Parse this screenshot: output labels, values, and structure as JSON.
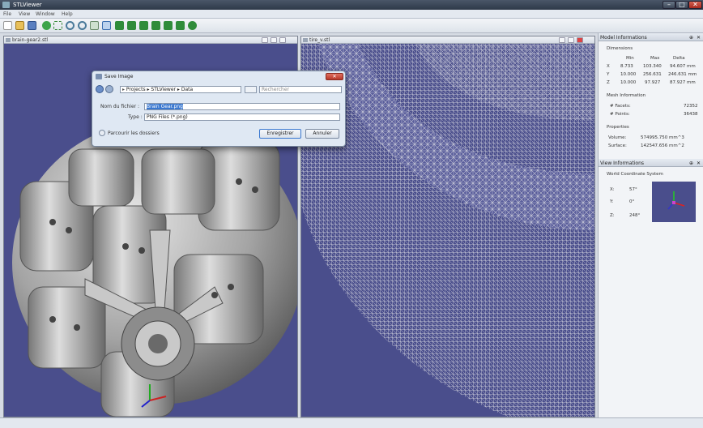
{
  "window": {
    "title": "STLViewer",
    "controls": [
      "–",
      "□",
      "✕"
    ]
  },
  "menu": [
    "File",
    "View",
    "Window",
    "Help"
  ],
  "toolbar": {
    "icons": [
      "new-file-icon",
      "open-folder-icon",
      "save-icon",
      "green-pin-icon",
      "fit-view-icon",
      "zoom-in-icon",
      "zoom-out-icon",
      "select-icon",
      "cube-front-icon",
      "cube-back-icon",
      "cube-left-icon",
      "cube-right-icon",
      "cube-top-icon",
      "cube-bottom-icon",
      "render-icon"
    ]
  },
  "viewport_left": {
    "title": "brain-gear2.stl",
    "background": "#4a4e8c"
  },
  "viewport_right": {
    "title": "tire_v.stl",
    "background": "#4a4e8c"
  },
  "model_panel": {
    "title": "Model Informations",
    "dimensions_label": "Dimensions",
    "col_headers": [
      "Min",
      "Max",
      "Delta"
    ],
    "rows": [
      {
        "axis": "X",
        "min": "8.733",
        "max": "103.340",
        "delta": "94.607 mm"
      },
      {
        "axis": "Y",
        "min": "10.000",
        "max": "256.631",
        "delta": "246.631 mm"
      },
      {
        "axis": "Z",
        "min": "10.000",
        "max": "97.927",
        "delta": "87.927 mm"
      }
    ],
    "mesh_label": "Mesh Information",
    "facets_label": "# Facets:",
    "facets": "72352",
    "points_label": "# Points:",
    "points": "36438",
    "properties_label": "Properties",
    "volume_label": "Volume:",
    "volume": "574995.750  mm^3",
    "surface_label": "Surface:",
    "surface": "142547.656  mm^2"
  },
  "view_panel": {
    "title": "View Informations",
    "system_label": "World Coordinate System",
    "x_label": "X:",
    "x": "57°",
    "y_label": "Y:",
    "y": "0°",
    "z_label": "Z:",
    "z": "248°"
  },
  "dialog": {
    "title": "Save Image",
    "path": [
      "Projects",
      "STLViewer",
      "Data"
    ],
    "search_placeholder": "Rechercher",
    "filename_label": "Nom du fichier :",
    "filename_value": "Brain Gear.png",
    "type_label": "Type :",
    "type_value": "PNG Files (*.png)",
    "browse_label": "Parcourir les dossiers",
    "save_label": "Enregistrer",
    "cancel_label": "Annuler"
  }
}
